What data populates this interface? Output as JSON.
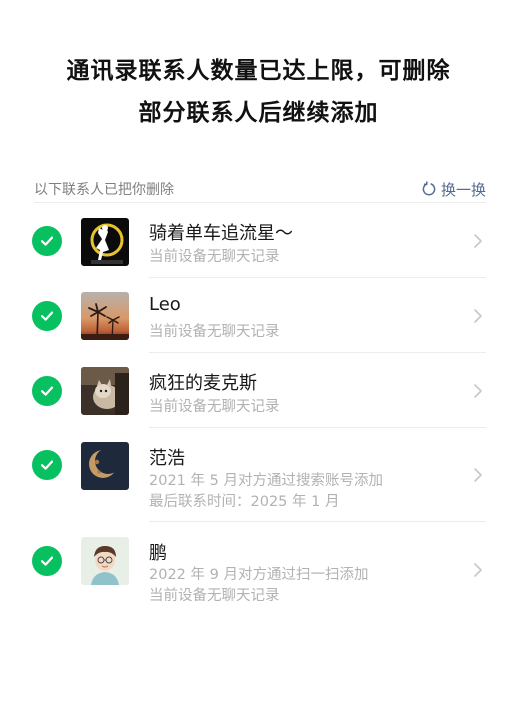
{
  "title": {
    "line1": "通讯录联系人数量已达上限，可删除",
    "line2": "部分联系人后继续添加"
  },
  "section": {
    "label": "以下联系人已把你删除",
    "refresh_label": "换一换"
  },
  "contacts": [
    {
      "name": "骑着单车追流星～",
      "line1": "当前设备无聊天记录",
      "line2": "",
      "checked": true,
      "avatar": "sailor-moon-silhouette"
    },
    {
      "name": "Leo",
      "line1": "当前设备无聊天记录",
      "line2": "",
      "checked": true,
      "avatar": "palm-sunset"
    },
    {
      "name": "疯狂的麦克斯",
      "line1": "当前设备无聊天记录",
      "line2": "",
      "checked": true,
      "avatar": "cat-photo"
    },
    {
      "name": "范浩",
      "line1": "2021 年 5 月对方通过搜索账号添加",
      "line2": "最后联系时间：2025 年 1 月",
      "checked": true,
      "avatar": "moon"
    },
    {
      "name": "鹏",
      "line1": "2022 年 9 月对方通过扫一扫添加",
      "line2": "当前设备无聊天记录",
      "checked": true,
      "avatar": "cartoon-boy"
    }
  ],
  "colors": {
    "accent_green": "#07c160",
    "link_blue": "#576b95",
    "secondary_text": "#b2b2b2"
  }
}
